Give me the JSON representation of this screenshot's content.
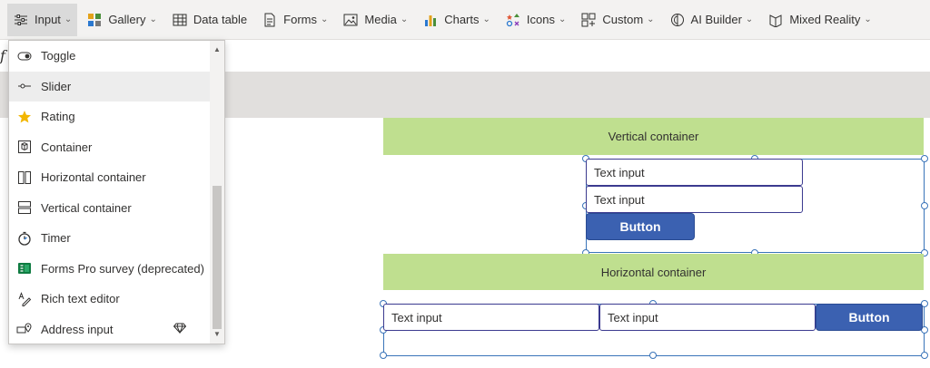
{
  "ribbon": {
    "items": [
      {
        "label": "Input",
        "icon": "input-icon",
        "chevron": true,
        "active": true
      },
      {
        "label": "Gallery",
        "icon": "gallery-icon",
        "chevron": true
      },
      {
        "label": "Data table",
        "icon": "table-icon",
        "chevron": false
      },
      {
        "label": "Forms",
        "icon": "forms-icon",
        "chevron": true
      },
      {
        "label": "Media",
        "icon": "media-icon",
        "chevron": true
      },
      {
        "label": "Charts",
        "icon": "charts-icon",
        "chevron": true
      },
      {
        "label": "Icons",
        "icon": "icons-icon",
        "chevron": true
      },
      {
        "label": "Custom",
        "icon": "custom-icon",
        "chevron": true
      },
      {
        "label": "AI Builder",
        "icon": "ai-builder-icon",
        "chevron": true
      },
      {
        "label": "Mixed Reality",
        "icon": "mixed-reality-icon",
        "chevron": true
      }
    ]
  },
  "formula_bar": {
    "fx": "f"
  },
  "dropdown": {
    "items": [
      {
        "label": "Toggle",
        "icon": "toggle-icon"
      },
      {
        "label": "Slider",
        "icon": "slider-icon",
        "hover": true
      },
      {
        "label": "Rating",
        "icon": "star-icon"
      },
      {
        "label": "Container",
        "icon": "container-icon"
      },
      {
        "label": "Horizontal container",
        "icon": "horizontal-container-icon"
      },
      {
        "label": "Vertical container",
        "icon": "vertical-container-icon"
      },
      {
        "label": "Timer",
        "icon": "timer-icon"
      },
      {
        "label": "Forms Pro survey (deprecated)",
        "icon": "forms-pro-icon"
      },
      {
        "label": "Rich text editor",
        "icon": "rich-text-icon"
      },
      {
        "label": "Address input",
        "icon": "address-input-icon",
        "premium": true
      }
    ]
  },
  "canvas": {
    "vertical_container_label": "Vertical container",
    "horizontal_container_label": "Horizontal container",
    "vertical": {
      "input1": "Text input",
      "input2": "Text input",
      "button": "Button"
    },
    "horizontal": {
      "input1": "Text input",
      "input2": "Text input",
      "button": "Button"
    }
  },
  "colors": {
    "accent": "#3b61b1",
    "green": "#bfdf8f",
    "selection": "#3a74b9"
  }
}
